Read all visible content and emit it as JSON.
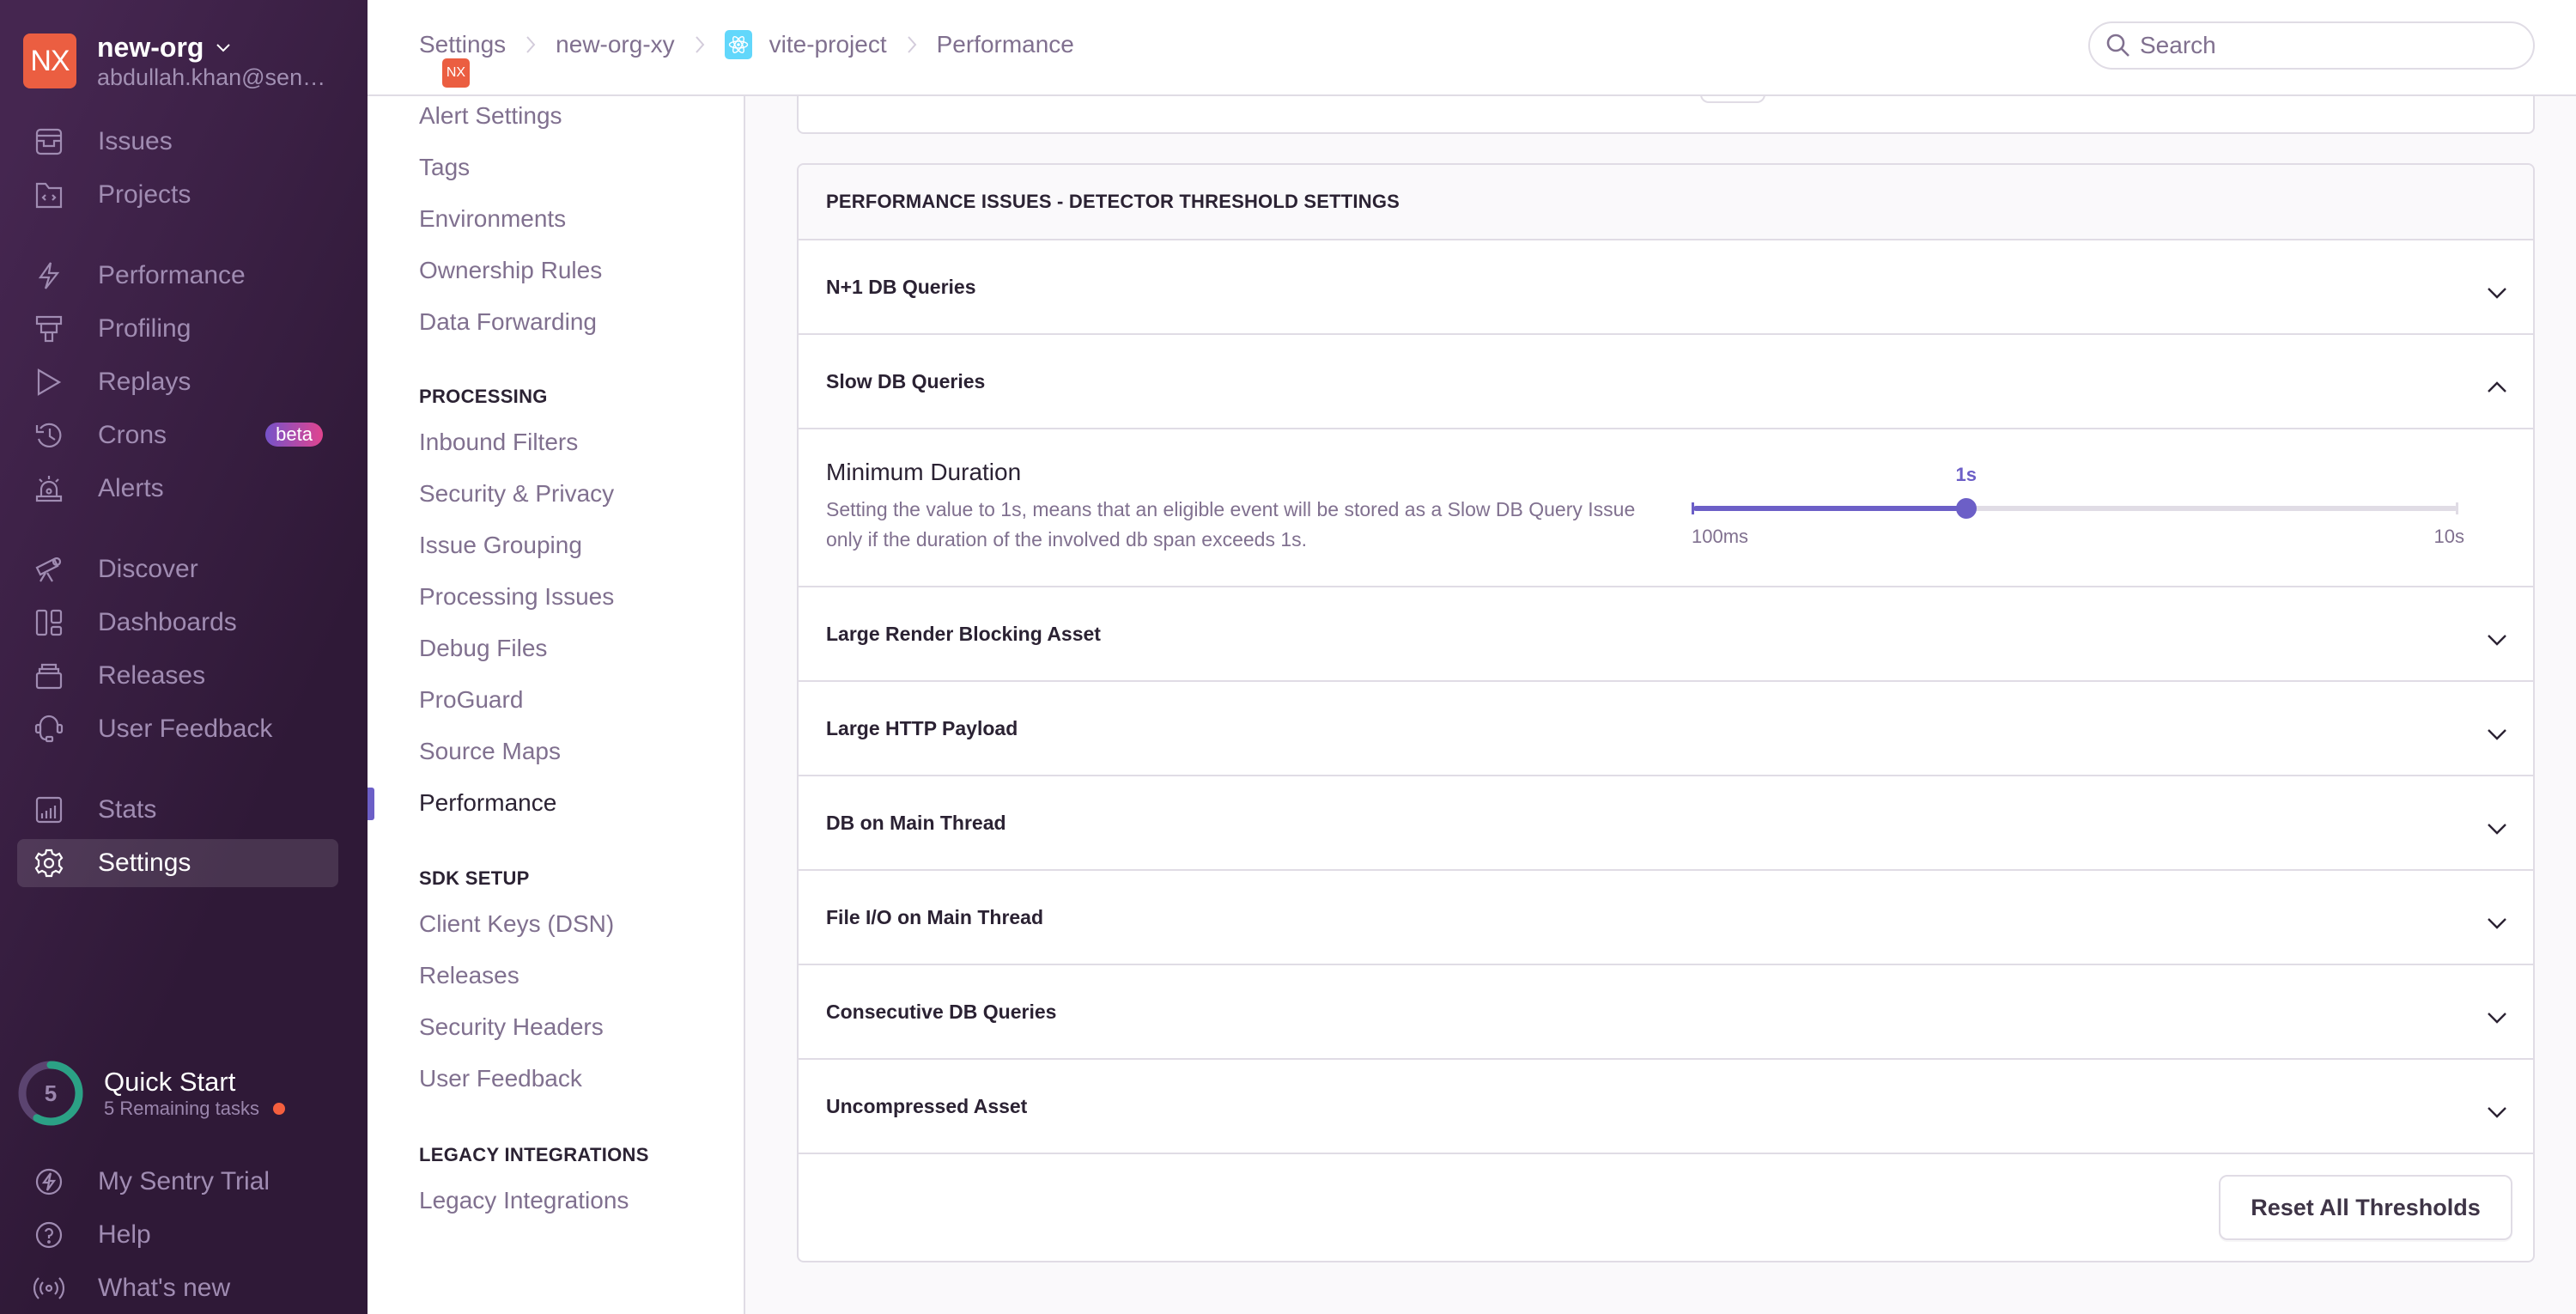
{
  "org": {
    "avatar_initials": "NX",
    "name": "new-org",
    "email": "abdullah.khan@sen…",
    "avatar_color": "#eb5e41"
  },
  "sidebar": {
    "items": [
      {
        "label": "Issues",
        "icon": "issues-icon"
      },
      {
        "label": "Projects",
        "icon": "projects-icon"
      },
      {
        "label": "Performance",
        "icon": "performance-icon"
      },
      {
        "label": "Profiling",
        "icon": "profiling-icon"
      },
      {
        "label": "Replays",
        "icon": "replays-icon"
      },
      {
        "label": "Crons",
        "icon": "crons-icon",
        "badge": "beta"
      },
      {
        "label": "Alerts",
        "icon": "alerts-icon"
      },
      {
        "label": "Discover",
        "icon": "discover-icon"
      },
      {
        "label": "Dashboards",
        "icon": "dashboards-icon"
      },
      {
        "label": "Releases",
        "icon": "releases-icon"
      },
      {
        "label": "User Feedback",
        "icon": "user-feedback-icon"
      },
      {
        "label": "Stats",
        "icon": "stats-icon"
      },
      {
        "label": "Settings",
        "icon": "settings-icon",
        "active": true
      }
    ],
    "quick_start": {
      "count": "5",
      "title": "Quick Start",
      "subtitle": "5 Remaining tasks",
      "progress_fraction": 0.58
    },
    "footer_items": [
      {
        "label": "My Sentry Trial",
        "icon": "trial-icon"
      },
      {
        "label": "Help",
        "icon": "help-icon"
      },
      {
        "label": "What's new",
        "icon": "broadcast-icon"
      }
    ]
  },
  "header": {
    "breadcrumb": [
      {
        "label": "Settings"
      },
      {
        "label": "new-org-xy",
        "badge": "NX"
      },
      {
        "label": "vite-project",
        "badge_icon": "react-icon"
      },
      {
        "label": "Performance"
      }
    ],
    "search_placeholder": "Search"
  },
  "subnav": {
    "top_items": [
      "Alert Settings",
      "Tags",
      "Environments",
      "Ownership Rules",
      "Data Forwarding"
    ],
    "sections": [
      {
        "heading": "PROCESSING",
        "items": [
          "Inbound Filters",
          "Security & Privacy",
          "Issue Grouping",
          "Processing Issues",
          "Debug Files",
          "ProGuard",
          "Source Maps",
          "Performance"
        ]
      },
      {
        "heading": "SDK SETUP",
        "items": [
          "Client Keys (DSN)",
          "Releases",
          "Security Headers",
          "User Feedback"
        ]
      },
      {
        "heading": "LEGACY INTEGRATIONS",
        "items": [
          "Legacy Integrations"
        ]
      }
    ],
    "active_item": "Performance"
  },
  "thresholds": {
    "title": "PERFORMANCE ISSUES - DETECTOR THRESHOLD SETTINGS",
    "rows": [
      {
        "label": "N+1 DB Queries",
        "expanded": false
      },
      {
        "label": "Slow DB Queries",
        "expanded": true
      },
      {
        "label": "Large Render Blocking Asset",
        "expanded": false
      },
      {
        "label": "Large HTTP Payload",
        "expanded": false
      },
      {
        "label": "DB on Main Thread",
        "expanded": false
      },
      {
        "label": "File I/O on Main Thread",
        "expanded": false
      },
      {
        "label": "Consecutive DB Queries",
        "expanded": false
      },
      {
        "label": "Uncompressed Asset",
        "expanded": false
      }
    ],
    "slow_db": {
      "field_label": "Minimum Duration",
      "help": "Setting the value to 1s, means that an eligible event will be stored as a Slow DB Query Issue only if the duration of the involved db span exceeds 1s.",
      "slider": {
        "value_label": "1s",
        "min_label": "100ms",
        "max_label": "10s",
        "position_fraction": 0.357
      }
    },
    "reset_button": "Reset All Thresholds"
  },
  "colors": {
    "accent": "#6c5fc7",
    "sidebar_dark": "#2f1937",
    "quick_start_ring": "#2ba185",
    "notification_dot": "#f55f3e"
  }
}
